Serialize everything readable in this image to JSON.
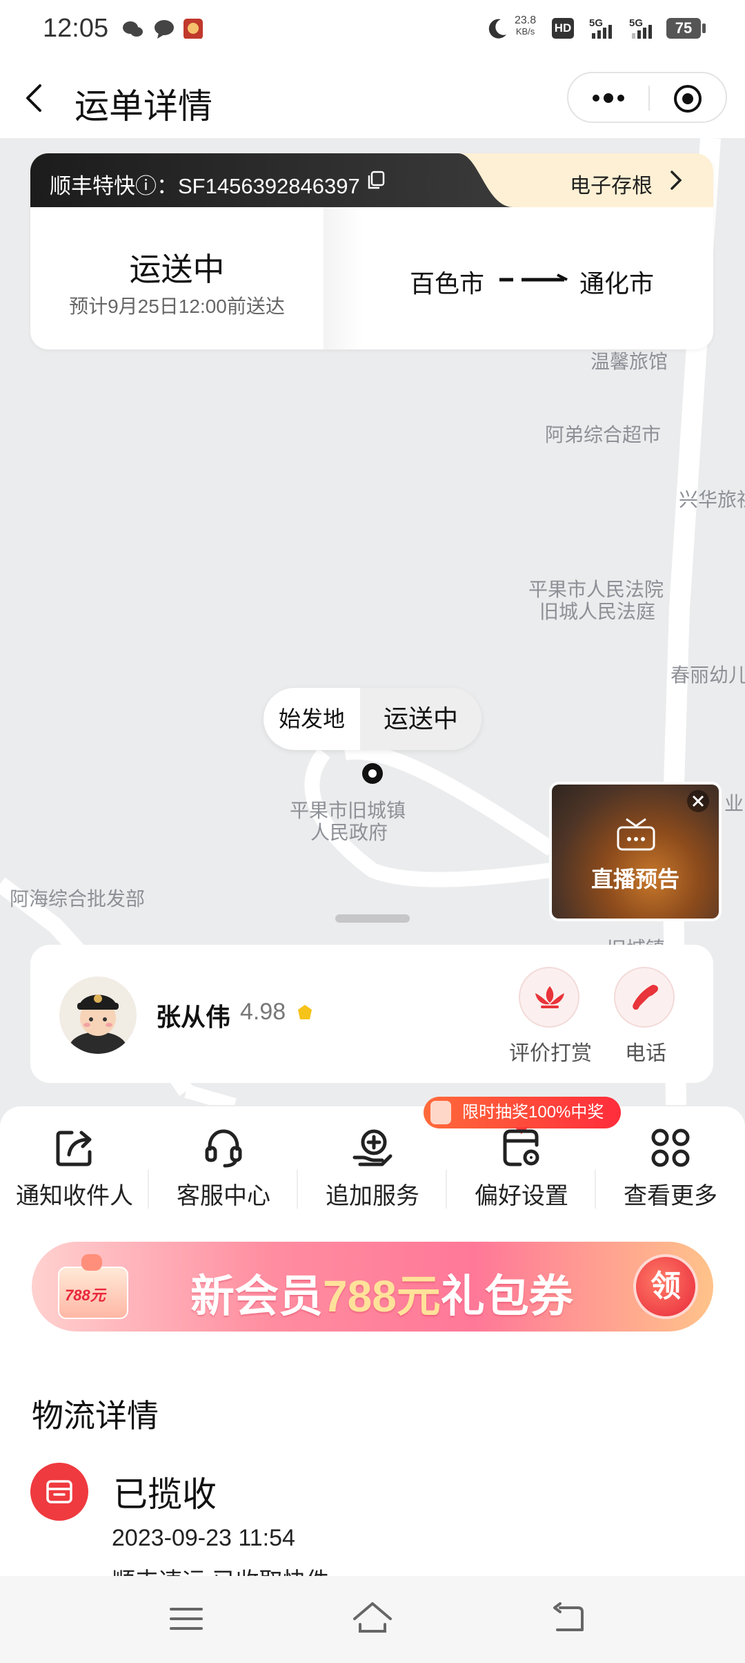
{
  "status_bar": {
    "time": "12:05",
    "net_speed": "23.8",
    "net_unit": "KB/s",
    "hd_label": "HD",
    "sig1": "5G",
    "sig2": "5G",
    "battery": "75"
  },
  "header": {
    "title": "运单详情"
  },
  "shipment": {
    "service_label": "顺丰特快ⓘ：SF1456392846397",
    "e_receipt": "电子存根",
    "status": "运送中",
    "eta": "预计9月25日12:00前送达",
    "from_city": "百色市",
    "to_city": "通化市"
  },
  "map": {
    "labels": [
      "温馨旅馆",
      "阿弟综合超市",
      "兴华旅社",
      "平果市人民法院",
      "旧城人民法庭",
      "春丽幼儿",
      "平果市旧城镇",
      "人民政府",
      "阿海综合批发部",
      "旧城镇",
      "业"
    ],
    "origin_chip": "始发地",
    "status_chip": "运送中",
    "live_preview": "直播预告"
  },
  "courier": {
    "name": "张从伟",
    "rating": "4.98",
    "reward_label": "评价打赏",
    "phone_label": "电话"
  },
  "actions": {
    "promo": "限时抽奖100%中奖",
    "items": [
      {
        "label": "通知收件人",
        "icon": "share-icon"
      },
      {
        "label": "客服中心",
        "icon": "headset-icon"
      },
      {
        "label": "追加服务",
        "icon": "add-service-icon"
      },
      {
        "label": "偏好设置",
        "icon": "preference-icon"
      },
      {
        "label": "查看更多",
        "icon": "grid-icon"
      }
    ]
  },
  "banner": {
    "pre": "新会员",
    "amount": "788元",
    "post": "礼包券",
    "gift_price": "788元",
    "button": "领"
  },
  "logistics": {
    "title": "物流详情",
    "status": "已揽收",
    "time": "2023-09-23 11:54",
    "desc": "顺丰速运 已收取快件"
  },
  "colors": {
    "accent_red": "#ef3a3f",
    "map_bg": "#ebeced",
    "receipt_bg": "#fdf0d4"
  }
}
